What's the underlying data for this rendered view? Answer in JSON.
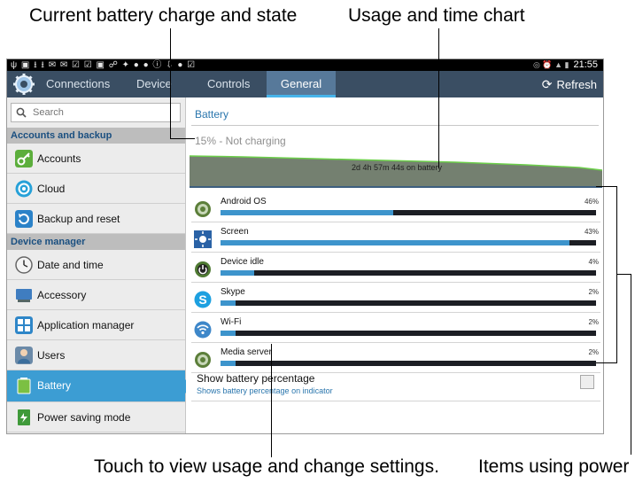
{
  "callouts": {
    "top_left": "Current battery charge and state",
    "top_right": "Usage and time chart",
    "bottom_left": "Touch to view usage and change settings.",
    "bottom_right": "Items using power"
  },
  "status_bar": {
    "time": "21:55"
  },
  "tabs": {
    "items": [
      "Connections",
      "Device",
      "Controls",
      "General"
    ],
    "active": "General",
    "refresh_label": "Refresh"
  },
  "sidebar": {
    "search_placeholder": "Search",
    "sections": [
      "Accounts and backup",
      "Device manager"
    ],
    "items": [
      "Accounts",
      "Cloud",
      "Backup and reset",
      "Date and time",
      "Accessory",
      "Application manager",
      "Users",
      "Battery",
      "Power saving mode"
    ],
    "selected": "Battery"
  },
  "battery": {
    "header": "Battery",
    "charge_status": "15% - Not charging",
    "chart_label": "2d 4h 57m 44s on battery",
    "usage": [
      {
        "name": "Android OS",
        "percent_label": "46%",
        "fill": 0.46
      },
      {
        "name": "Screen",
        "percent_label": "43%",
        "fill": 0.93
      },
      {
        "name": "Device idle",
        "percent_label": "4%",
        "fill": 0.09
      },
      {
        "name": "Skype",
        "percent_label": "2%",
        "fill": 0.04
      },
      {
        "name": "Wi-Fi",
        "percent_label": "2%",
        "fill": 0.04
      },
      {
        "name": "Media server",
        "percent_label": "2%",
        "fill": 0.04
      }
    ],
    "show_percentage": {
      "title": "Show battery percentage",
      "subtitle": "Shows battery percentage on indicator",
      "checked": false
    }
  },
  "colors": {
    "tab_bar": "#3a4e63",
    "tab_active": "#57799a",
    "accent": "#3c9dd3",
    "usage_fill": "#3d94cc",
    "usage_track": "#1c1e24"
  }
}
